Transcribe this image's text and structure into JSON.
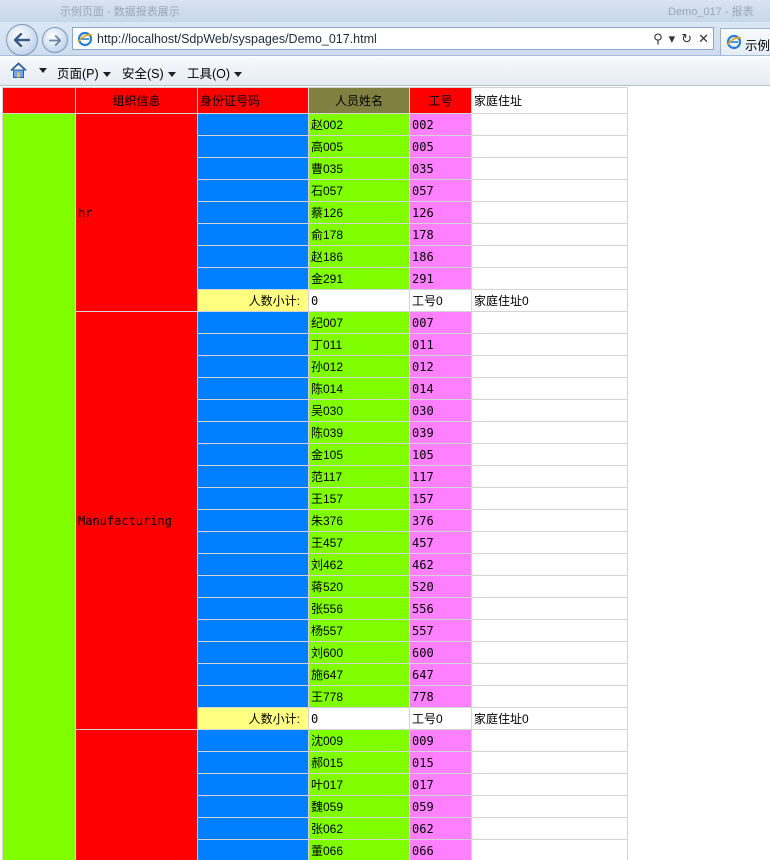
{
  "browser": {
    "title_left": "示例页面 - 数据报表展示",
    "title_right": "Demo_017 - 报表",
    "url": "http://localhost/SdpWeb/syspages/Demo_017.html",
    "tab_label": "示例_",
    "menu": {
      "page": "页面(P)",
      "security": "安全(S)",
      "tools": "工具(O)"
    }
  },
  "table": {
    "headers": {
      "org": "组织信息",
      "id_card": "身份证号码",
      "name": "人员姓名",
      "emp_no": "工号",
      "address": "家庭住址"
    },
    "subtotal": {
      "label": "人数小计:",
      "count": "0",
      "emp_no": "工号0",
      "address": "家庭住址0"
    },
    "groups": [
      {
        "org": "hr",
        "rows": [
          {
            "name": "赵002",
            "no": "002"
          },
          {
            "name": "高005",
            "no": "005"
          },
          {
            "name": "曹035",
            "no": "035"
          },
          {
            "name": "石057",
            "no": "057"
          },
          {
            "name": "蔡126",
            "no": "126"
          },
          {
            "name": "俞178",
            "no": "178"
          },
          {
            "name": "赵186",
            "no": "186"
          },
          {
            "name": "金291",
            "no": "291"
          }
        ],
        "has_subtotal": true
      },
      {
        "org": "Manufacturing",
        "rows": [
          {
            "name": "纪007",
            "no": "007"
          },
          {
            "name": "丁011",
            "no": "011"
          },
          {
            "name": "孙012",
            "no": "012"
          },
          {
            "name": "陈014",
            "no": "014"
          },
          {
            "name": "吴030",
            "no": "030"
          },
          {
            "name": "陈039",
            "no": "039"
          },
          {
            "name": "金105",
            "no": "105"
          },
          {
            "name": "范117",
            "no": "117"
          },
          {
            "name": "王157",
            "no": "157"
          },
          {
            "name": "朱376",
            "no": "376"
          },
          {
            "name": "王457",
            "no": "457"
          },
          {
            "name": "刘462",
            "no": "462"
          },
          {
            "name": "蒋520",
            "no": "520"
          },
          {
            "name": "张556",
            "no": "556"
          },
          {
            "name": "杨557",
            "no": "557"
          },
          {
            "name": "刘600",
            "no": "600"
          },
          {
            "name": "施647",
            "no": "647"
          },
          {
            "name": "王778",
            "no": "778"
          }
        ],
        "has_subtotal": true
      },
      {
        "org": "",
        "rows": [
          {
            "name": "沈009",
            "no": "009"
          },
          {
            "name": "郝015",
            "no": "015"
          },
          {
            "name": "叶017",
            "no": "017"
          },
          {
            "name": "魏059",
            "no": "059"
          },
          {
            "name": "张062",
            "no": "062"
          },
          {
            "name": "董066",
            "no": "066"
          }
        ],
        "has_subtotal": false
      }
    ]
  },
  "colors": {
    "seq_col": "#80ff00",
    "org_col": "#ff0000",
    "id_col": "#0080ff",
    "name_col": "#80ff00",
    "no_col": "#ff80ff",
    "header_name": "#808040",
    "subtotal_label": "#ffff80"
  }
}
